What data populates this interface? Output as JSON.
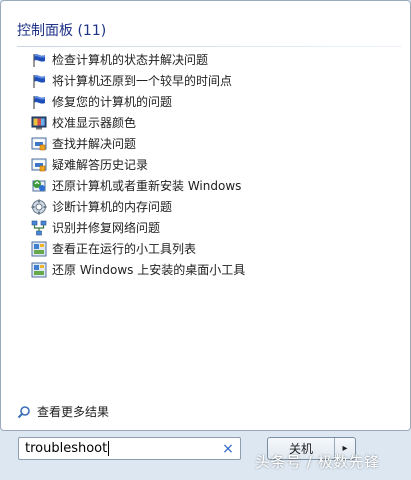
{
  "group": {
    "title": "控制面板 (11)"
  },
  "results": [
    {
      "icon": "flag-icon",
      "label": "检查计算机的状态并解决问题"
    },
    {
      "icon": "flag-icon",
      "label": "将计算机还原到一个较早的时间点"
    },
    {
      "icon": "flag-icon",
      "label": "修复您的计算机的问题"
    },
    {
      "icon": "monitor-icon",
      "label": "校准显示器颜色"
    },
    {
      "icon": "troubleshoot-icon",
      "label": "查找并解决问题"
    },
    {
      "icon": "troubleshoot-icon",
      "label": "疑难解答历史记录"
    },
    {
      "icon": "recovery-icon",
      "label": "还原计算机或者重新安装 Windows"
    },
    {
      "icon": "diagnostic-icon",
      "label": "诊断计算机的内存问题"
    },
    {
      "icon": "network-icon",
      "label": "识别并修复网络问题"
    },
    {
      "icon": "gadget-icon",
      "label": "查看正在运行的小工具列表"
    },
    {
      "icon": "gadget-icon",
      "label": "还原 Windows 上安装的桌面小工具"
    }
  ],
  "more_results": {
    "label": "查看更多结果",
    "icon": "search-icon"
  },
  "search": {
    "value": "troubleshoot",
    "clear_glyph": "×"
  },
  "shutdown": {
    "label": "关机",
    "arrow_glyph": "▸"
  },
  "watermark": {
    "text": "头条号 / 极数先锋"
  },
  "colors": {
    "header": "#1e3287",
    "accent": "#2a63c5",
    "panel_bg": "#ffffff",
    "frame_bg": "#dce7f2"
  }
}
